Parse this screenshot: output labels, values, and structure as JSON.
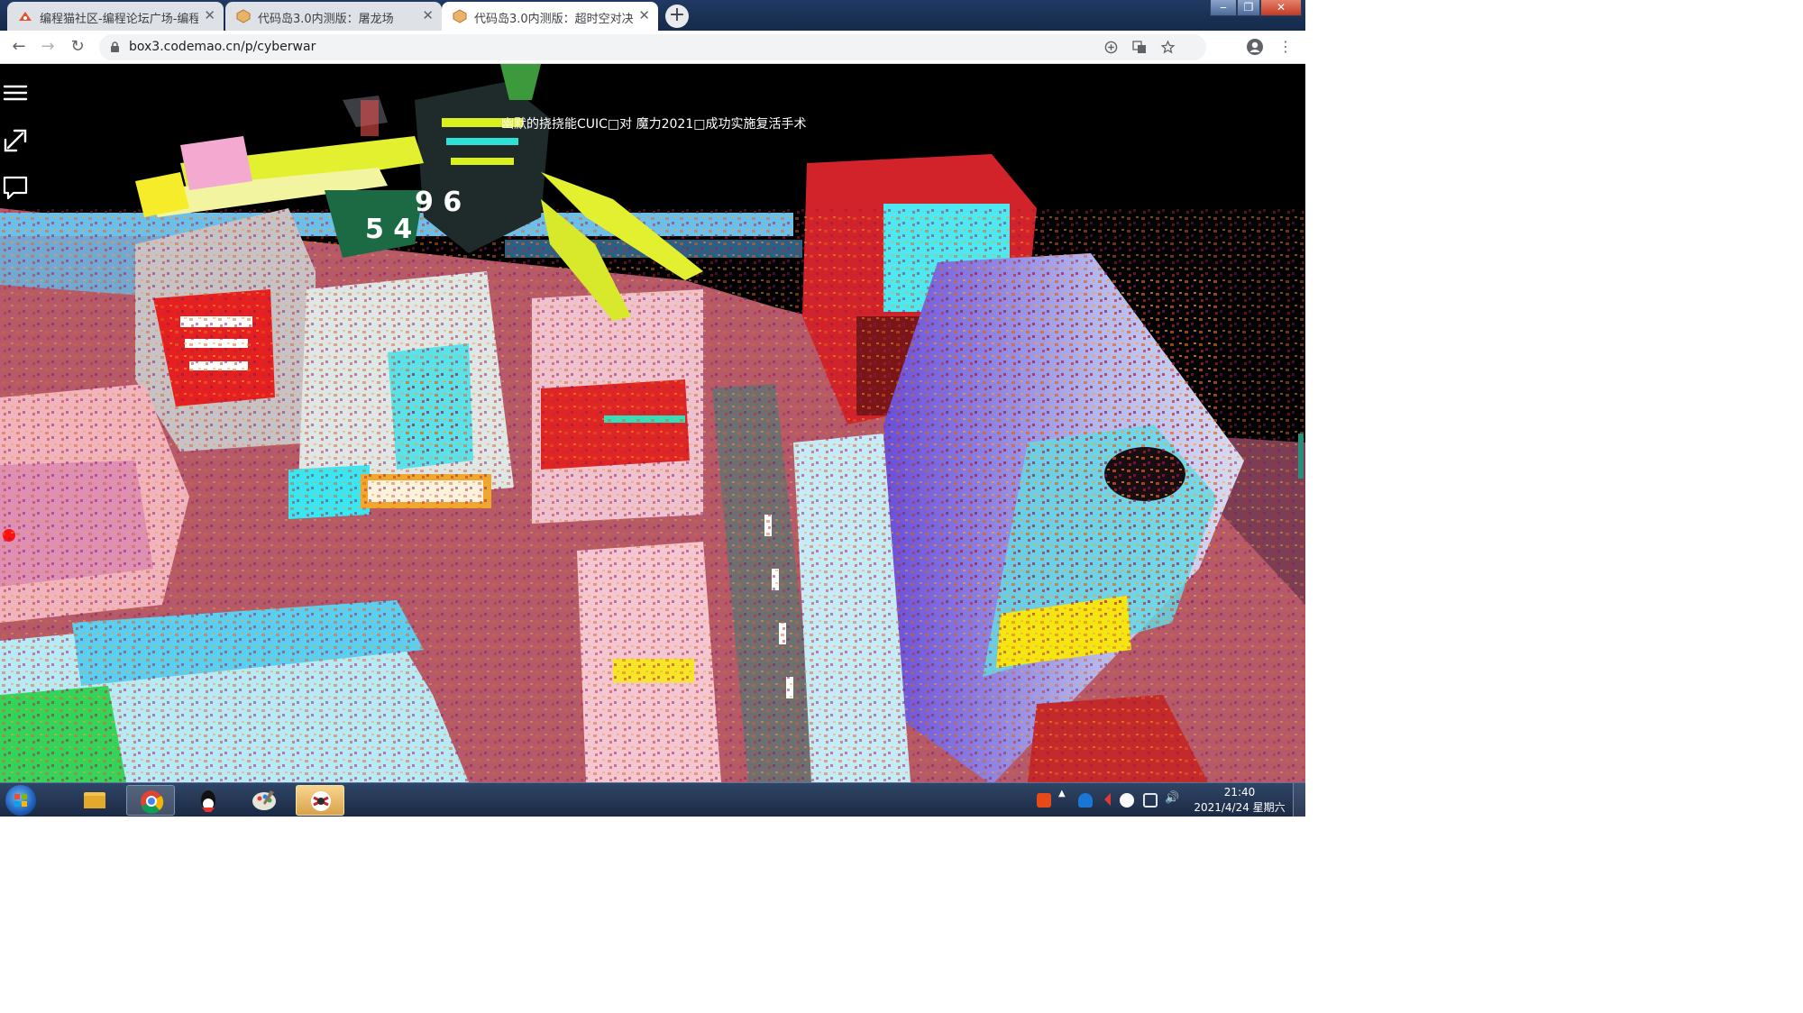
{
  "browser": {
    "tabs": [
      {
        "title": "编程猫社区-编程论坛广场-编程",
        "close": "✕"
      },
      {
        "title": "代码岛3.0内测版：屠龙场",
        "close": "✕"
      },
      {
        "title": "代码岛3.0内测版：超时空对决",
        "close": "✕"
      }
    ],
    "new_tab": "+",
    "window_controls": [
      "‒",
      "❐",
      "✕"
    ],
    "url": "box3.codemao.cn/p/cyberwar"
  },
  "game": {
    "banner": "幽默的挠挠能CUIC□对 魔力2021□成功实施复活手术",
    "floating_numbers": [
      "9 6",
      "5 4"
    ],
    "hud": [
      "menu-icon",
      "fullscreen-exit-icon",
      "chat-icon"
    ]
  },
  "taskbar": {
    "apps": [
      "file-explorer-icon",
      "chrome-icon",
      "qq-icon",
      "paint-icon",
      "game-icon"
    ],
    "time": "21:40",
    "date": "2021/4/24 星期六"
  },
  "colors": {
    "tabbar": "#1a3157",
    "active_tab": "#ffffff",
    "sky": "#000000",
    "neon_red": "#e8261f",
    "neon_cyan": "#39e6f2",
    "neon_yellow": "#f5e613"
  }
}
